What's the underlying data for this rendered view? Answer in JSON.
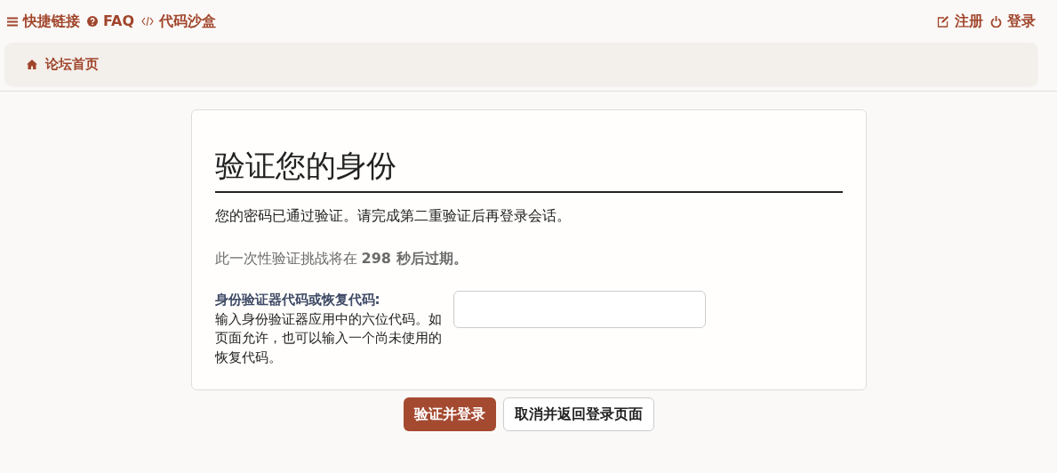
{
  "top_nav": {
    "left": [
      {
        "kind": "menu",
        "label": "快捷链接"
      },
      {
        "kind": "help",
        "label": "FAQ"
      },
      {
        "kind": "code",
        "label": "代码沙盒"
      }
    ],
    "right": [
      {
        "kind": "edit",
        "label": "注册"
      },
      {
        "kind": "power",
        "label": "登录"
      }
    ]
  },
  "breadcrumb": {
    "label": "论坛首页"
  },
  "panel": {
    "heading": "验证您的身份",
    "intro": "您的密码已通过验证。请完成第二重验证后再登录会话。",
    "expiry": "此一次性验证挑战将在 **298 秒后过期。**",
    "field": {
      "label": "身份验证器代码或恢复代码:",
      "hint": "输入身份验证器应用中的六位代码。如页面允许，也可以输入一个尚未使用的恢复代码。"
    }
  },
  "buttons": [
    {
      "kind": "primary",
      "label": "验证并登录"
    },
    {
      "kind": "secondary",
      "label": "取消并返回登录页面"
    }
  ]
}
